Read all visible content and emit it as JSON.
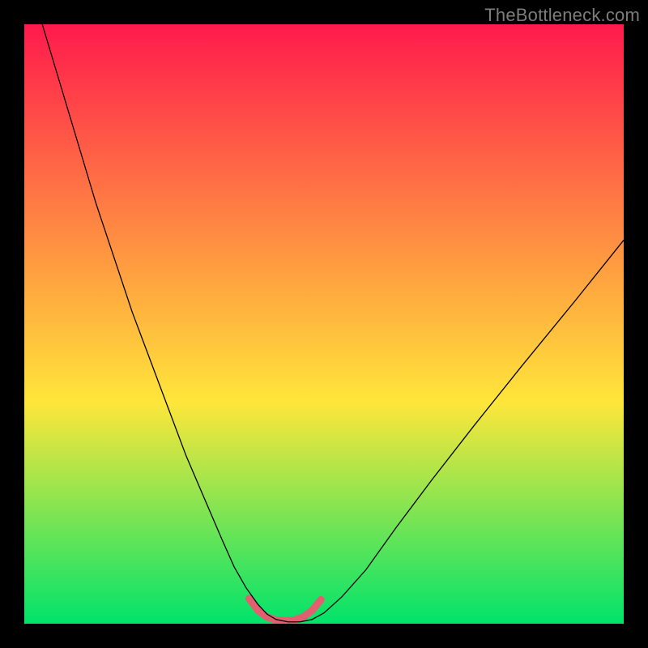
{
  "watermark": "TheBottleneck.com",
  "chart_data": {
    "type": "line",
    "title": "",
    "xlabel": "",
    "ylabel": "",
    "xlim": [
      0,
      100
    ],
    "ylim": [
      0,
      100
    ],
    "grid": false,
    "legend": false,
    "background_gradient": {
      "top_color": "#ff1a4c",
      "mid_color": "#ffe63a",
      "bottom_color": "#00e36b"
    },
    "series": [
      {
        "name": "curve",
        "color": "#000000",
        "stroke_width": 1.3,
        "x": [
          3,
          6,
          9,
          12,
          15,
          18,
          21,
          24,
          27,
          30,
          33,
          35,
          37,
          39,
          40.5,
          42,
          44,
          46,
          48,
          50,
          53,
          57,
          62,
          68,
          75,
          83,
          92,
          100
        ],
        "y": [
          100,
          90,
          80,
          70,
          61,
          52,
          44,
          36,
          28,
          21,
          14,
          9.5,
          6,
          3.2,
          1.6,
          0.7,
          0.3,
          0.3,
          0.7,
          1.8,
          4.5,
          9,
          16,
          24,
          33,
          43,
          54,
          64
        ]
      },
      {
        "name": "highlight",
        "color": "#e06070",
        "stroke_width": 9,
        "linecap": "round",
        "x": [
          37.5,
          39,
          40.5,
          42,
          43.5,
          45,
          46.5,
          48,
          49.5
        ],
        "y": [
          4.2,
          2.2,
          1.1,
          0.6,
          0.5,
          0.6,
          1.1,
          2.2,
          4.0
        ]
      }
    ],
    "annotations": []
  }
}
